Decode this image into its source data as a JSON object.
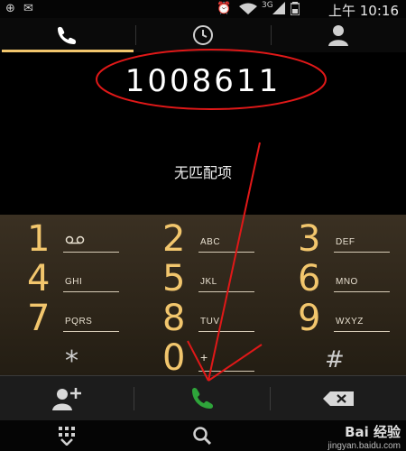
{
  "status_bar": {
    "time": "上午 10:16",
    "network": "3G"
  },
  "tabs": [
    {
      "name": "phone",
      "icon": "phone-icon",
      "active": true
    },
    {
      "name": "recent",
      "icon": "clock-icon",
      "active": false
    },
    {
      "name": "contacts",
      "icon": "person-icon",
      "active": false
    }
  ],
  "display": {
    "number": "1008611",
    "no_match": "无匹配项"
  },
  "keypad": {
    "keys": [
      {
        "digit": "1",
        "letters": ""
      },
      {
        "digit": "2",
        "letters": "ABC"
      },
      {
        "digit": "3",
        "letters": "DEF"
      },
      {
        "digit": "4",
        "letters": "GHI"
      },
      {
        "digit": "5",
        "letters": "JKL"
      },
      {
        "digit": "6",
        "letters": "MNO"
      },
      {
        "digit": "7",
        "letters": "PQRS"
      },
      {
        "digit": "8",
        "letters": "TUV"
      },
      {
        "digit": "9",
        "letters": "WXYZ"
      },
      {
        "digit": "*",
        "letters": ""
      },
      {
        "digit": "0",
        "letters": "+"
      },
      {
        "digit": "#",
        "letters": ""
      }
    ]
  },
  "watermark": {
    "main": "Bai 经验",
    "sub": "jingyan.baidu.com"
  },
  "colors": {
    "accent": "#f2c66d",
    "call": "#2ea43a",
    "annotation": "#e01818"
  }
}
